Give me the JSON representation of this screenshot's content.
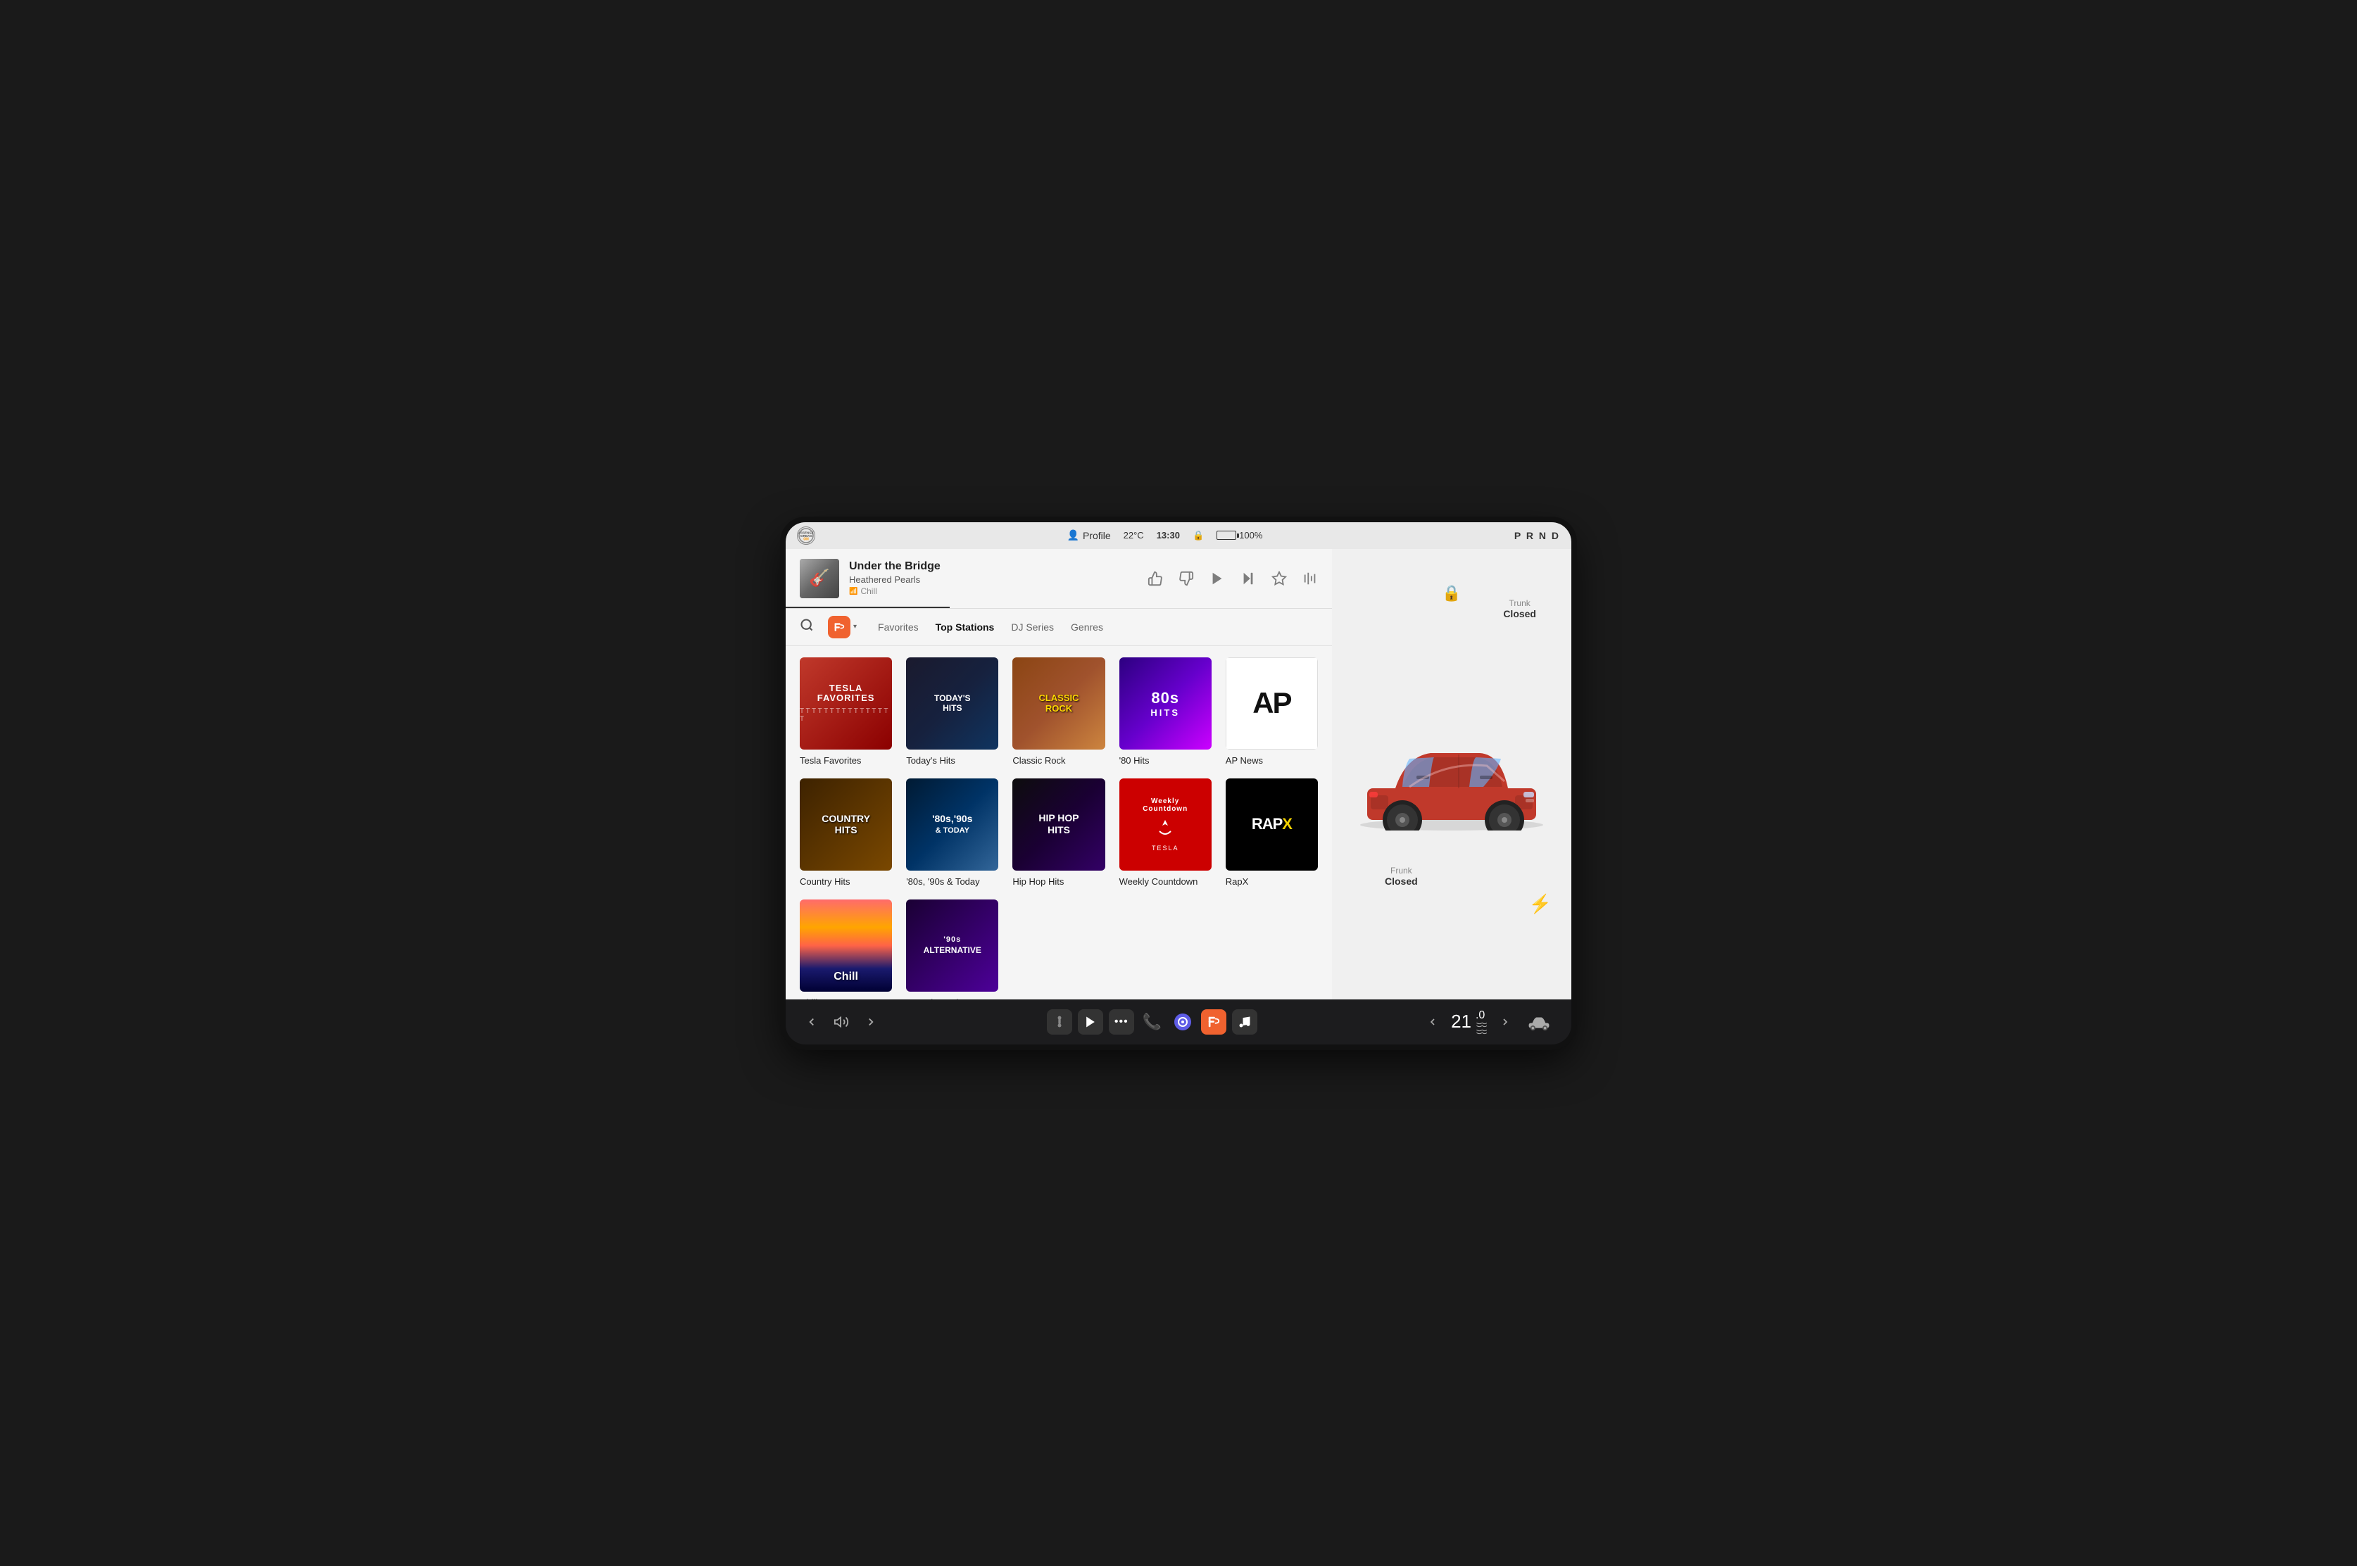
{
  "screen": {
    "border_radius": "28px"
  },
  "status_bar": {
    "airbag_line1": "PASSENGER",
    "airbag_line2": "AIRBAG",
    "airbag_status": "ON",
    "profile_label": "Profile",
    "temperature": "22°C",
    "time": "13:30",
    "lock_icon": "🔒",
    "battery_percent": "100%",
    "gear": "P R N D"
  },
  "now_playing": {
    "title": "Under the Bridge",
    "artist": "Heathered Pearls",
    "station": "Chill",
    "album_art_emoji": "🎸"
  },
  "controls": {
    "thumbs_up": "👍",
    "thumbs_down": "👎",
    "play": "▶",
    "next": "⏭",
    "star": "★",
    "equalizer": "equalizer-icon"
  },
  "music_nav": {
    "search_icon": "🔍",
    "service_icon": "📊",
    "dropdown_arrow": "▾",
    "tabs": [
      {
        "id": "favorites",
        "label": "Favorites",
        "active": false
      },
      {
        "id": "top-stations",
        "label": "Top Stations",
        "active": true
      },
      {
        "id": "dj-series",
        "label": "DJ Series",
        "active": false
      },
      {
        "id": "genres",
        "label": "Genres",
        "active": false
      }
    ]
  },
  "stations": [
    {
      "id": "tesla-favorites",
      "label": "Tesla Favorites",
      "art_type": "tesla-fav"
    },
    {
      "id": "todays-hits",
      "label": "Today's Hits",
      "art_type": "todays-hits"
    },
    {
      "id": "classic-rock",
      "label": "Classic Rock",
      "art_type": "classic-rock"
    },
    {
      "id": "80s-hits",
      "label": "'80 Hits",
      "art_type": "80s-hits"
    },
    {
      "id": "ap-news",
      "label": "AP News",
      "art_type": "ap-news"
    },
    {
      "id": "country-hits",
      "label": "Country Hits",
      "art_type": "country"
    },
    {
      "id": "80s90s-today",
      "label": "'80s, '90s & Today",
      "art_type": "80s90s"
    },
    {
      "id": "hip-hop-hits",
      "label": "Hip Hop Hits",
      "art_type": "hiphop"
    },
    {
      "id": "weekly-countdown",
      "label": "Weekly Countdown",
      "art_type": "weekly"
    },
    {
      "id": "rapx",
      "label": "RapX",
      "art_type": "rapx"
    },
    {
      "id": "chill",
      "label": "Chill",
      "art_type": "chill"
    },
    {
      "id": "90s-alternative",
      "label": "'90s Alternative",
      "art_type": "90s-alt"
    }
  ],
  "car": {
    "frunk_label": "Frunk",
    "frunk_status": "Closed",
    "trunk_label": "Trunk",
    "trunk_status": "Closed"
  },
  "bottom_nav": {
    "back_icon": "‹",
    "volume_icon": "🔊",
    "forward_icon": "›",
    "temperature": "21",
    "temp_unit": ".0",
    "nav_left_chevron": "‹",
    "nav_right_chevron": "›",
    "apps": [
      {
        "id": "joystick",
        "icon": "🕹",
        "label": "autopilot"
      },
      {
        "id": "media-player",
        "icon": "▶",
        "label": "media"
      },
      {
        "id": "dots",
        "icon": "•••",
        "label": "more"
      },
      {
        "id": "phone",
        "icon": "📞",
        "label": "phone",
        "active_color": "#30d158"
      },
      {
        "id": "circle-app",
        "icon": "⬤",
        "label": "circle-app"
      },
      {
        "id": "pandora",
        "icon": "📊",
        "label": "pandora"
      },
      {
        "id": "music-note",
        "icon": "♪",
        "label": "music"
      }
    ]
  }
}
